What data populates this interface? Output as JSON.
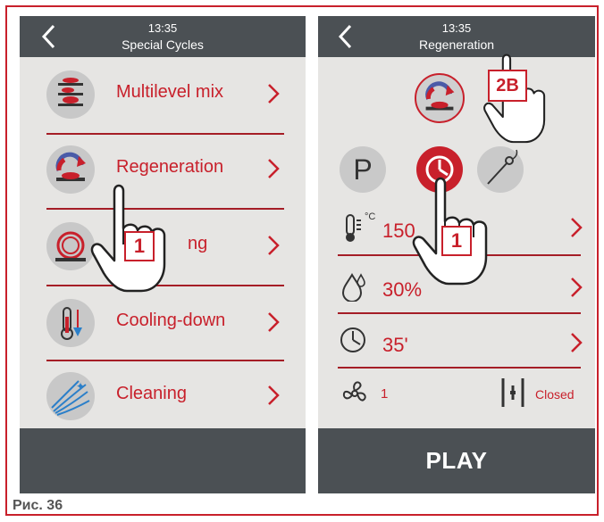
{
  "left_screen": {
    "time": "13:35",
    "title": "Special Cycles",
    "items": [
      {
        "label": "Multilevel mix",
        "icon": "multilevel-icon"
      },
      {
        "label": "Regeneration",
        "icon": "regeneration-icon"
      },
      {
        "label": "ng",
        "icon": "plates-icon"
      },
      {
        "label": "Cooling-down",
        "icon": "thermometer-cooling-icon"
      },
      {
        "label": "Cleaning",
        "icon": "cleaning-icon"
      }
    ],
    "callout": "1"
  },
  "right_screen": {
    "time": "13:35",
    "title": "Regeneration",
    "mode_p": "P",
    "temperature": {
      "value": "150",
      "unit": "°C"
    },
    "humidity": "30%",
    "time_value": "35'",
    "fan_speed": "1",
    "valve_state": "Closed",
    "play_label": "PLAY",
    "callout_1": "1",
    "callout_2b": "2B"
  },
  "caption": "Рис. 36",
  "colors": {
    "accent": "#c8202b",
    "header": "#4b5054",
    "screen_bg": "#e6e5e3"
  }
}
